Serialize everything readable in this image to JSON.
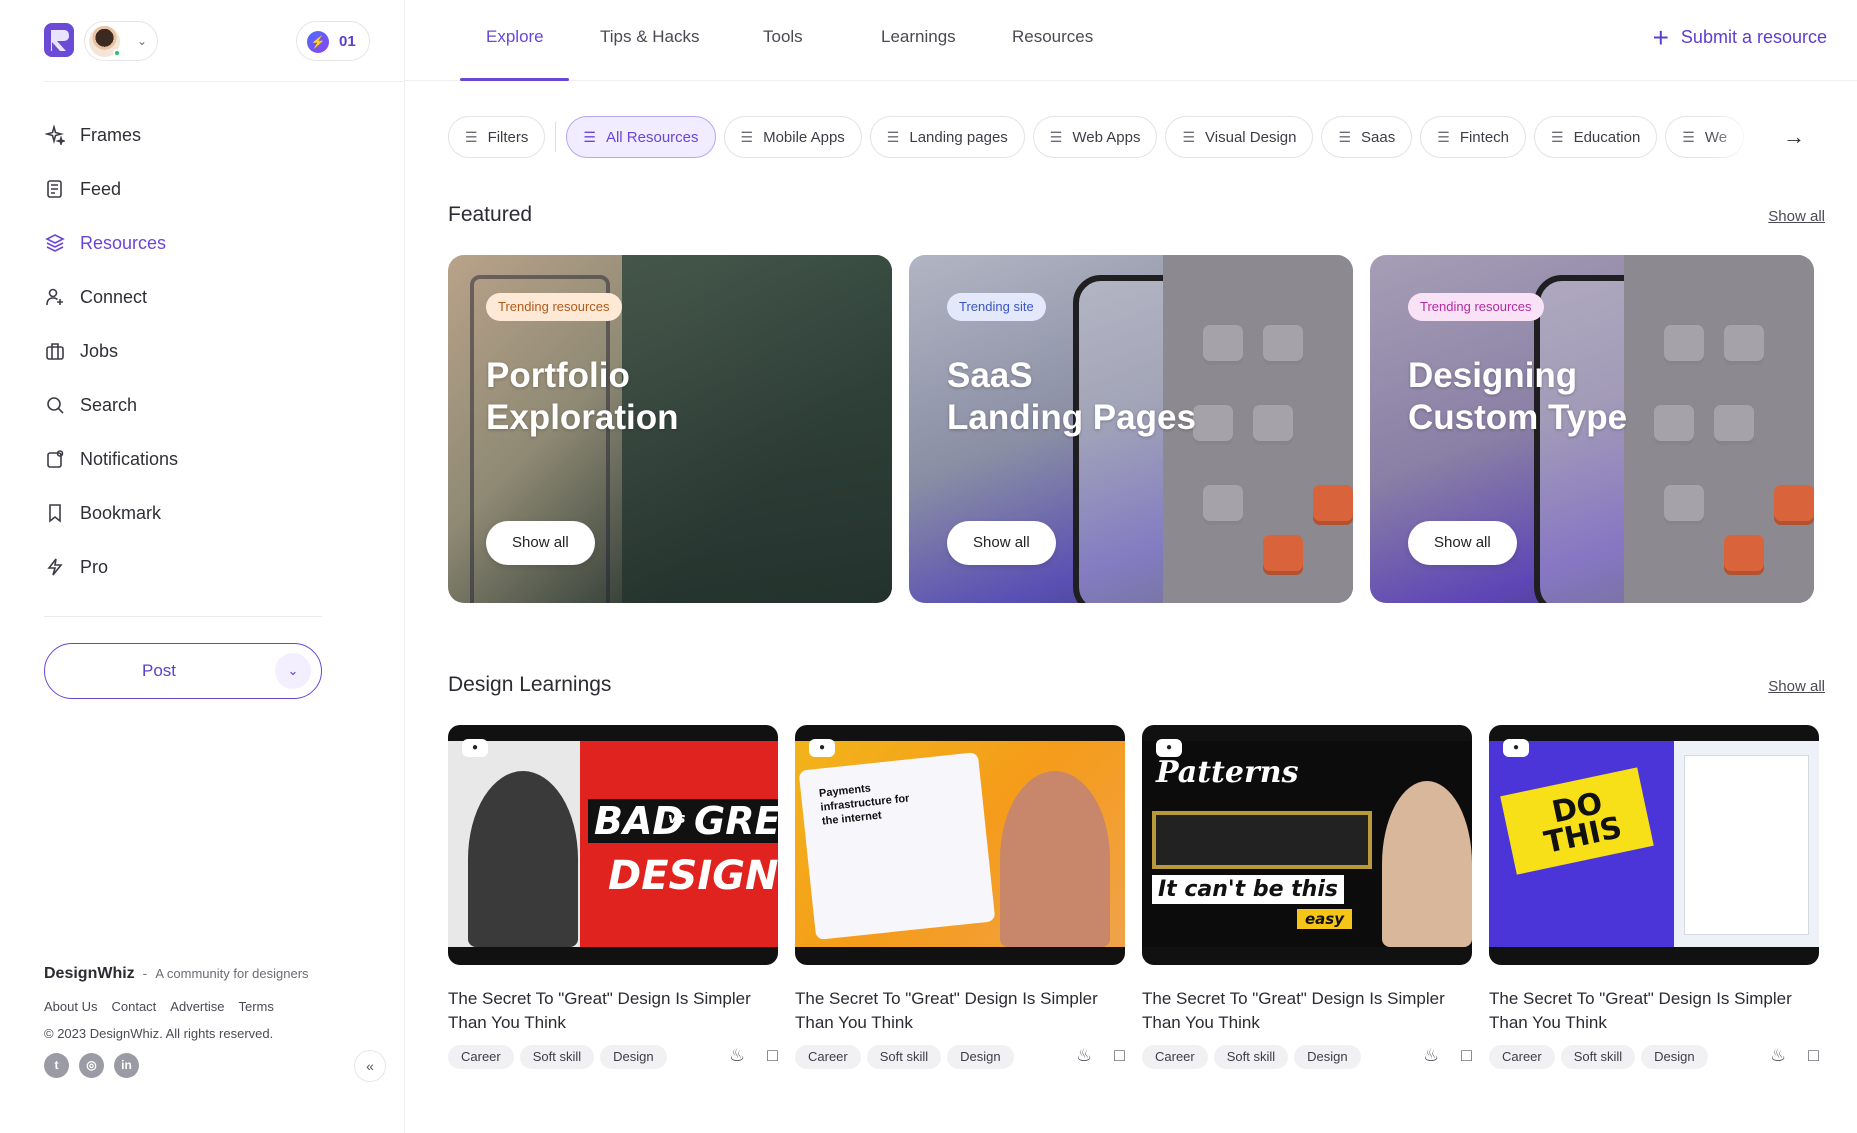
{
  "sidebar": {
    "credits": "01",
    "nav": [
      {
        "label": "Frames",
        "icon": "sparkle-icon"
      },
      {
        "label": "Feed",
        "icon": "feed-icon"
      },
      {
        "label": "Resources",
        "icon": "layers-icon",
        "active": true
      },
      {
        "label": "Connect",
        "icon": "user-plus-icon"
      },
      {
        "label": "Jobs",
        "icon": "briefcase-icon"
      },
      {
        "label": "Search",
        "icon": "search-icon"
      },
      {
        "label": "Notifications",
        "icon": "bell-icon"
      },
      {
        "label": "Bookmark",
        "icon": "bookmark-icon"
      },
      {
        "label": "Pro",
        "icon": "bolt-icon"
      }
    ],
    "post_label": "Post",
    "footer": {
      "brand": "DesignWhiz",
      "dash": "-",
      "tagline": "A community for designers",
      "links": [
        "About Us",
        "Contact",
        "Advertise",
        "Terms"
      ],
      "copyright": "© 2023 DesignWhiz. All rights reserved."
    }
  },
  "topnav": {
    "tabs": [
      "Explore",
      "Tips & Hacks",
      "Tools",
      "Learnings",
      "Resources"
    ],
    "active_tab": "Explore",
    "submit_label": "Submit a resource"
  },
  "filters": {
    "filters_label": "Filters",
    "chips": [
      "All Resources",
      "Mobile Apps",
      "Landing pages",
      "Web Apps",
      "Visual Design",
      "Saas",
      "Fintech",
      "Education",
      "We"
    ],
    "active_chip": "All Resources"
  },
  "featured": {
    "title": "Featured",
    "show_all": "Show all",
    "cards": [
      {
        "badge": "Trending resources",
        "title_line1": "Portfolio",
        "title_line2": "Exploration",
        "button": "Show all"
      },
      {
        "badge": "Trending site",
        "title_line1": "SaaS",
        "title_line2": "Landing Pages",
        "button": "Show all"
      },
      {
        "badge": "Trending resources",
        "title_line1": "Designing",
        "title_line2": "Custom Type",
        "button": "Show all"
      }
    ]
  },
  "learnings": {
    "title": "Design Learnings",
    "show_all": "Show all",
    "cards": [
      {
        "thumb_text1": "BAD",
        "thumb_text2": "GREA",
        "thumb_text3": "DESIGNER",
        "thumb_vs": "vs",
        "title": "The Secret To \"Great\" Design Is Simpler Than You Think",
        "tags": [
          "Career",
          "Soft skill",
          "Design"
        ]
      },
      {
        "thumb_text1": "Payments infrastructure for the internet",
        "title": "The Secret To \"Great\" Design Is Simpler Than You Think",
        "tags": [
          "Career",
          "Soft skill",
          "Design"
        ]
      },
      {
        "thumb_text1": "Patterns",
        "thumb_text2": "It can't be this",
        "thumb_text3": "easy",
        "title": "The Secret To \"Great\" Design Is Simpler Than You Think",
        "tags": [
          "Career",
          "Soft skill",
          "Design"
        ]
      },
      {
        "thumb_text1": "DO THIS",
        "title": "The Secret To \"Great\" Design Is Simpler Than You Think",
        "tags": [
          "Career",
          "Soft skill",
          "Design"
        ]
      }
    ]
  },
  "colors": {
    "accent": "#6a46d8",
    "background": "#ffffff"
  }
}
